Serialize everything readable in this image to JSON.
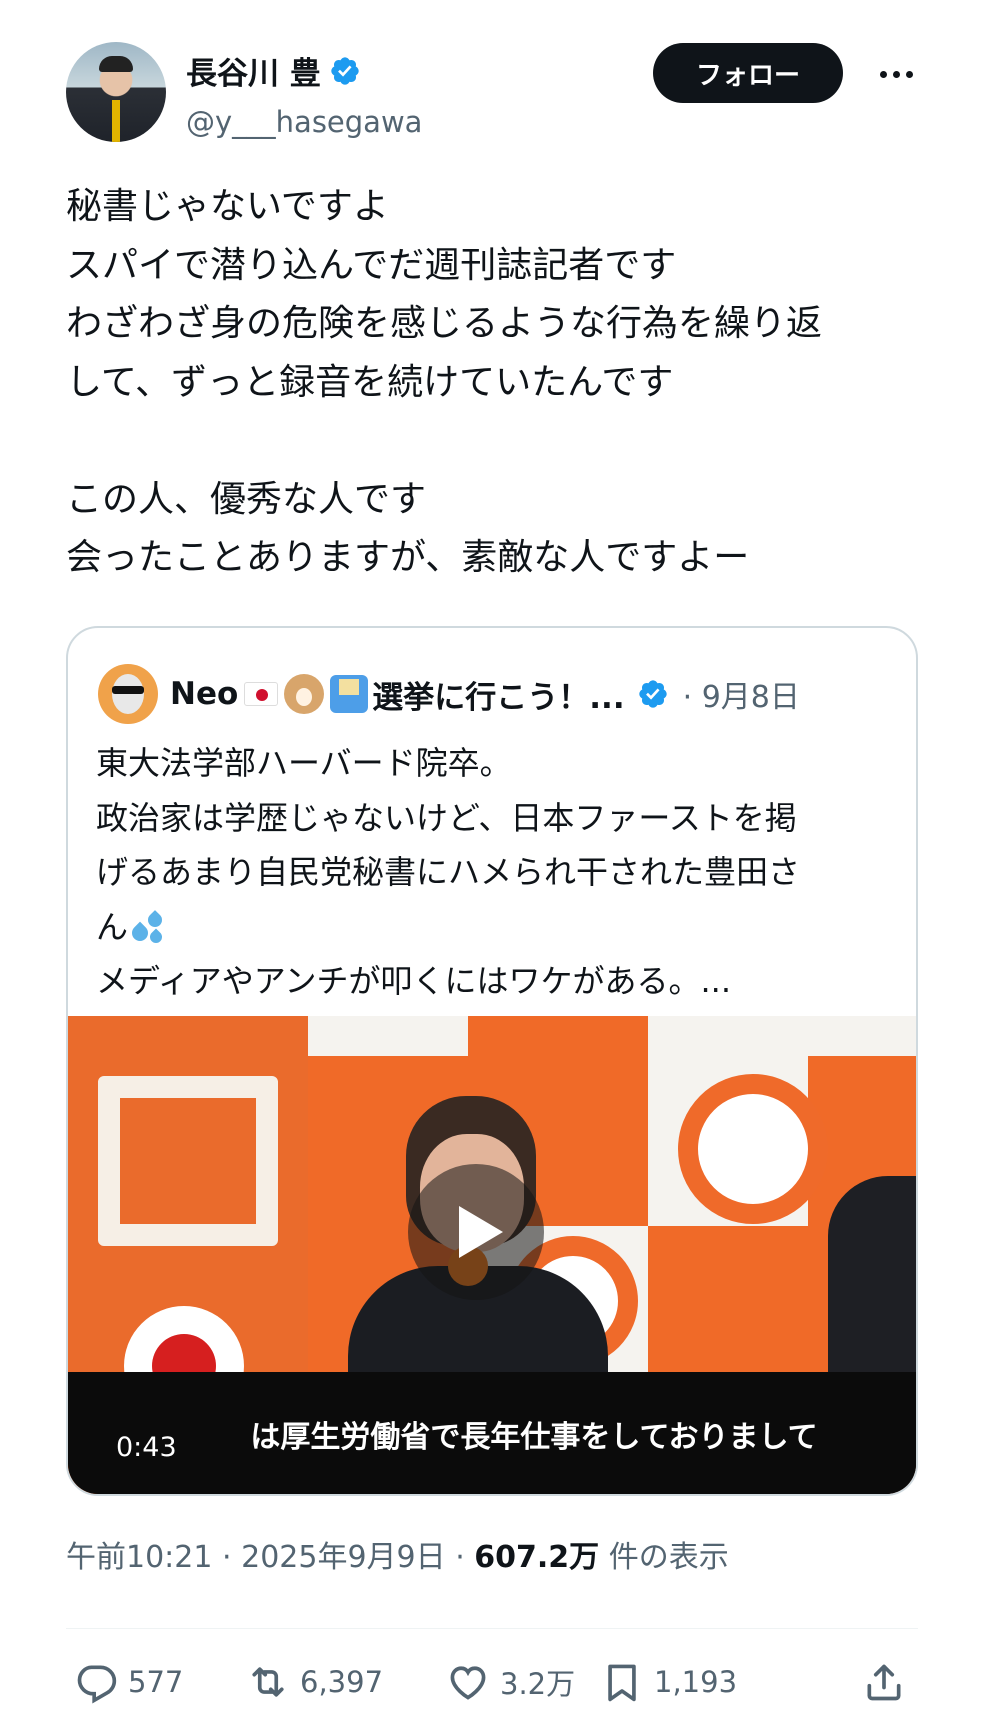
{
  "author": {
    "display_name": "長谷川 豊",
    "handle": "@y___hasegawa",
    "verified": true
  },
  "buttons": {
    "follow_label": "フォロー"
  },
  "tweet": {
    "lines": [
      "秘書じゃないですよ",
      "スパイで潜り込んでだ週刊誌記者です",
      "わざわざ身の危険を感じるような行為を繰り返",
      "して、ずっと録音を続けていたんです",
      "",
      "この人、優秀な人です",
      "会ったことありますが、素敵な人ですよー"
    ],
    "time": "午前10:21",
    "date": "2025年9月9日",
    "views_count": "607.2万",
    "views_label": "件の表示",
    "separator": "·"
  },
  "quoted": {
    "name": "Neo",
    "name_suffix": "選挙に行こう！...",
    "date": "· 9月8日",
    "lines": [
      "東大法学部ハーバード院卒。",
      "政治家は学歴じゃないけど、日本ファーストを掲",
      "げるあまり自民党秘書にハメられ干された豊田さ",
      "ん",
      "メディアやアンチが叩くにはワケがある。..."
    ],
    "video": {
      "caption": "は厚生労働省で長年仕事をしておりまして",
      "duration": "0:43"
    }
  },
  "actions": {
    "replies": "577",
    "reposts": "6,397",
    "likes": "3.2万",
    "bookmarks": "1,193"
  },
  "colors": {
    "text": "#0f1419",
    "secondary": "#536471",
    "verified": "#1d9bf0",
    "border": "#cfd9de",
    "follow_bg": "#0f1419"
  },
  "icons": [
    "verified-badge-icon",
    "more-icon",
    "play-icon",
    "reply-icon",
    "repost-icon",
    "like-icon",
    "bookmark-icon",
    "share-icon"
  ]
}
